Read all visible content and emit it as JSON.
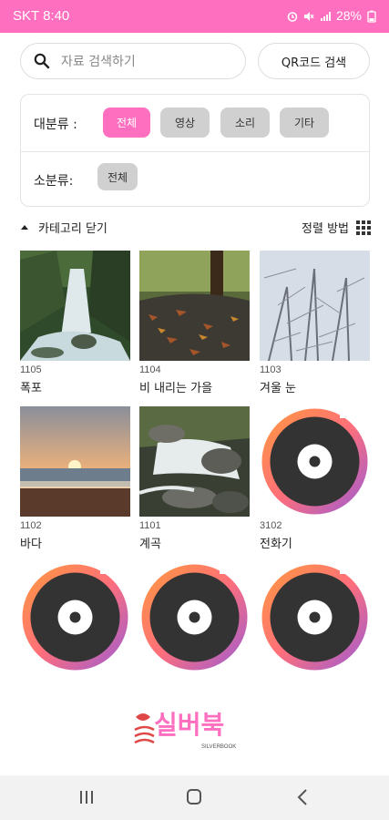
{
  "status_bar": {
    "carrier_time": "SKT 8:40",
    "battery": "28%"
  },
  "search": {
    "placeholder": "자료 검색하기",
    "qr_label": "QR코드 검색"
  },
  "filters": {
    "major_label": "대분류 :",
    "major_chips": [
      "전체",
      "영상",
      "소리",
      "기타"
    ],
    "major_selected": "전체",
    "minor_label": "소분류:",
    "minor_chips": [
      "전체"
    ]
  },
  "category_toggle": "카테고리 닫기",
  "sort_label": "정렬 방법",
  "items": [
    {
      "code": "1105",
      "title": "폭포",
      "thumb": "waterfall"
    },
    {
      "code": "1104",
      "title": "비 내리는 가을",
      "thumb": "autumn-rain"
    },
    {
      "code": "1103",
      "title": "겨울 눈",
      "thumb": "winter-snow"
    },
    {
      "code": "1102",
      "title": "바다",
      "thumb": "sea-sunset"
    },
    {
      "code": "1101",
      "title": "계곡",
      "thumb": "valley-stream"
    },
    {
      "code": "3102",
      "title": "전화기",
      "thumb": "audio-disc"
    },
    {
      "code": "",
      "title": "",
      "thumb": "audio-disc"
    },
    {
      "code": "",
      "title": "",
      "thumb": "audio-disc"
    },
    {
      "code": "",
      "title": "",
      "thumb": "audio-disc"
    }
  ],
  "logo": {
    "text": "실버북",
    "subtext": "SILVERBOOK"
  },
  "colors": {
    "accent": "#ff6fbf",
    "chip_inactive": "#d0d0d0"
  }
}
